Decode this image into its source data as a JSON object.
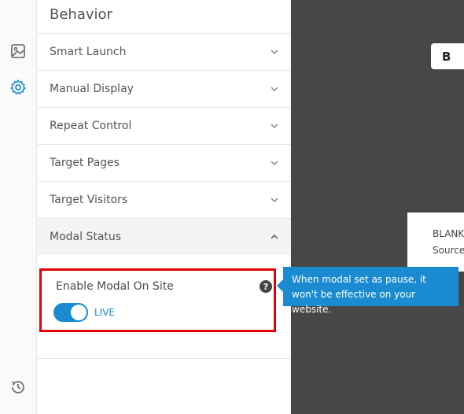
{
  "sidebar": {
    "icons": [
      "image-icon",
      "gear-icon",
      "history-icon"
    ],
    "accent_color": "#1a8bd0"
  },
  "panel": {
    "title": "Behavior",
    "sections": [
      {
        "label": "Smart Launch"
      },
      {
        "label": "Manual Display"
      },
      {
        "label": "Repeat Control"
      },
      {
        "label": "Target Pages"
      },
      {
        "label": "Target Visitors"
      },
      {
        "label": "Modal Status"
      }
    ],
    "modal_status": {
      "enable_label": "Enable Modal On Site",
      "help_symbol": "?",
      "toggle_state": "on",
      "status_text": "LIVE"
    }
  },
  "tooltip": {
    "text": "When modal set as pause, it won't be effective on your website."
  },
  "canvas": {
    "button_label": "B",
    "card_line1": "BLANK",
    "card_line2": "Source"
  },
  "highlight_color": "#e60000"
}
